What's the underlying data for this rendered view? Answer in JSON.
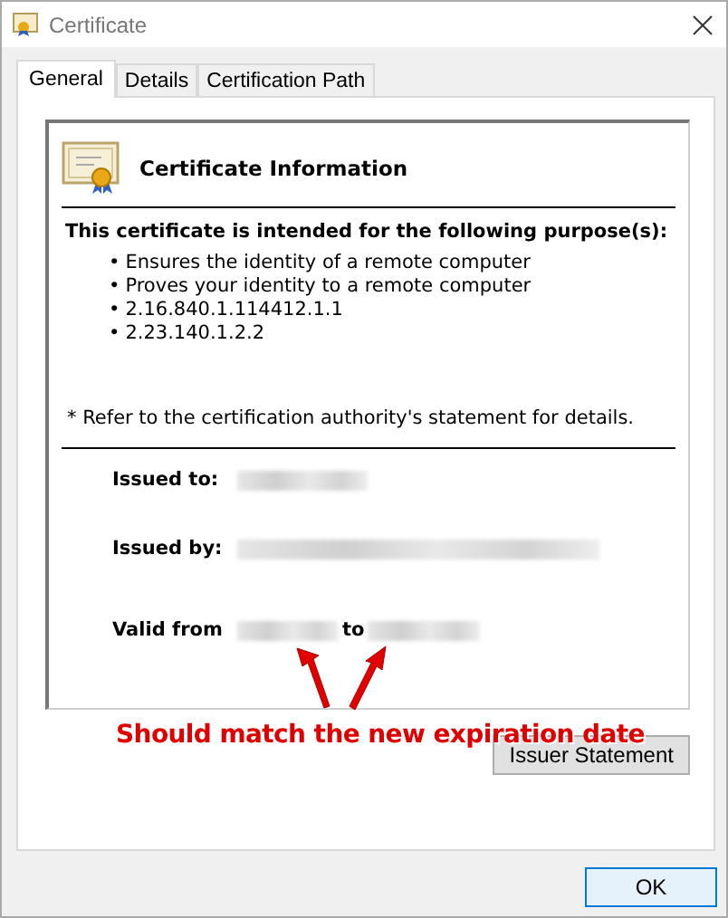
{
  "window": {
    "title": "Certificate"
  },
  "tabs": [
    {
      "label": "General",
      "selected": true
    },
    {
      "label": "Details",
      "selected": false
    },
    {
      "label": "Certification Path",
      "selected": false
    }
  ],
  "info": {
    "title": "Certificate Information",
    "purpose_heading": "This certificate is intended for the following purpose(s):",
    "purposes": [
      "Ensures the identity of a remote computer",
      "Proves your identity to a remote computer",
      "2.16.840.1.114412.1.1",
      "2.23.140.1.2.2"
    ],
    "bullet": "•",
    "note": "* Refer to the certification authority's statement for details.",
    "issued_to_label": "Issued to:",
    "issued_by_label": "Issued by:",
    "valid_from_label": "Valid from",
    "valid_to_label": "to"
  },
  "annotation": {
    "text": "Should match the new expiration date"
  },
  "buttons": {
    "issuer_statement": "Issuer Statement",
    "ok": "OK"
  }
}
